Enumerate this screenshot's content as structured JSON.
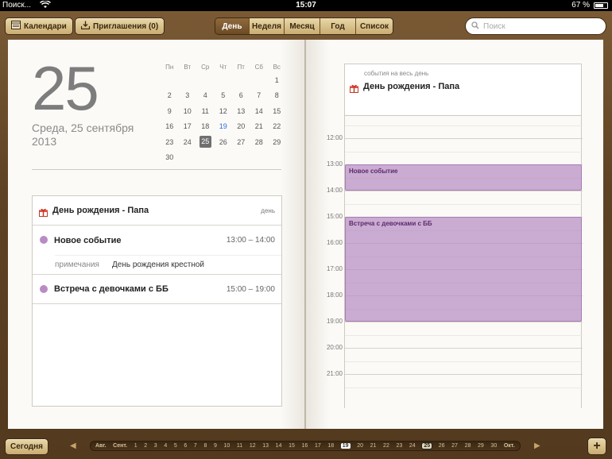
{
  "status_bar": {
    "carrier": "Поиск...",
    "time": "15:07",
    "battery": "67 %"
  },
  "toolbar": {
    "calendars_label": "Календари",
    "invitations_label": "Приглашения (0)",
    "views": [
      "День",
      "Неделя",
      "Месяц",
      "Год",
      "Список"
    ],
    "active_view": "День",
    "search_placeholder": "Поиск"
  },
  "left_page": {
    "day_number": "25",
    "date_text": "Среда, 25 сентября 2013",
    "mini_calendar": {
      "weekdays": [
        "Пн",
        "Вт",
        "Ср",
        "Чт",
        "Пт",
        "Сб",
        "Вс"
      ],
      "weeks": [
        [
          "",
          "",
          "",
          "",
          "",
          "",
          "1"
        ],
        [
          "2",
          "3",
          "4",
          "5",
          "6",
          "7",
          "8"
        ],
        [
          "9",
          "10",
          "11",
          "12",
          "13",
          "14",
          "15"
        ],
        [
          "16",
          "17",
          "18",
          "19",
          "20",
          "21",
          "22"
        ],
        [
          "23",
          "24",
          "25",
          "26",
          "27",
          "28",
          "29"
        ],
        [
          "30",
          "",
          "",
          "",
          "",
          "",
          ""
        ]
      ],
      "today": "19",
      "selected": "25"
    },
    "events": [
      {
        "title": "День рождения - Папа",
        "time": "день",
        "kind": "birthday"
      },
      {
        "title": "Новое событие",
        "time": "13:00 – 14:00",
        "kind": "event",
        "note_label": "примечания",
        "note_value": "День рождения крестной"
      },
      {
        "title": "Встреча  с девочками с ББ",
        "time": "15:00 – 19:00",
        "kind": "event"
      }
    ]
  },
  "right_page": {
    "allday_label": "события на весь день",
    "allday_event": "День рождения - Папа",
    "hours": [
      "12:00",
      "13:00",
      "14:00",
      "15:00",
      "16:00",
      "17:00",
      "18:00",
      "19:00",
      "20:00",
      "21:00"
    ],
    "timed_events": [
      {
        "title": "Новое событие",
        "start": 13,
        "end": 14
      },
      {
        "title": "Встреча  с девочками с ББ",
        "start": 15,
        "end": 19
      }
    ]
  },
  "bottom_bar": {
    "today_label": "Сегодня",
    "add_label": "+",
    "strip": [
      "Авг.",
      "Сент.",
      "1",
      "2",
      "3",
      "4",
      "5",
      "6",
      "7",
      "8",
      "9",
      "10",
      "11",
      "12",
      "13",
      "14",
      "15",
      "16",
      "17",
      "18",
      "19",
      "20",
      "21",
      "22",
      "23",
      "24",
      "25",
      "26",
      "27",
      "28",
      "29",
      "30",
      "Окт."
    ],
    "strip_today": "19",
    "strip_selected": "25"
  },
  "colors": {
    "event": "#b88cc3",
    "leather": "#5e4224",
    "accent_blue": "#2b6fd6"
  }
}
